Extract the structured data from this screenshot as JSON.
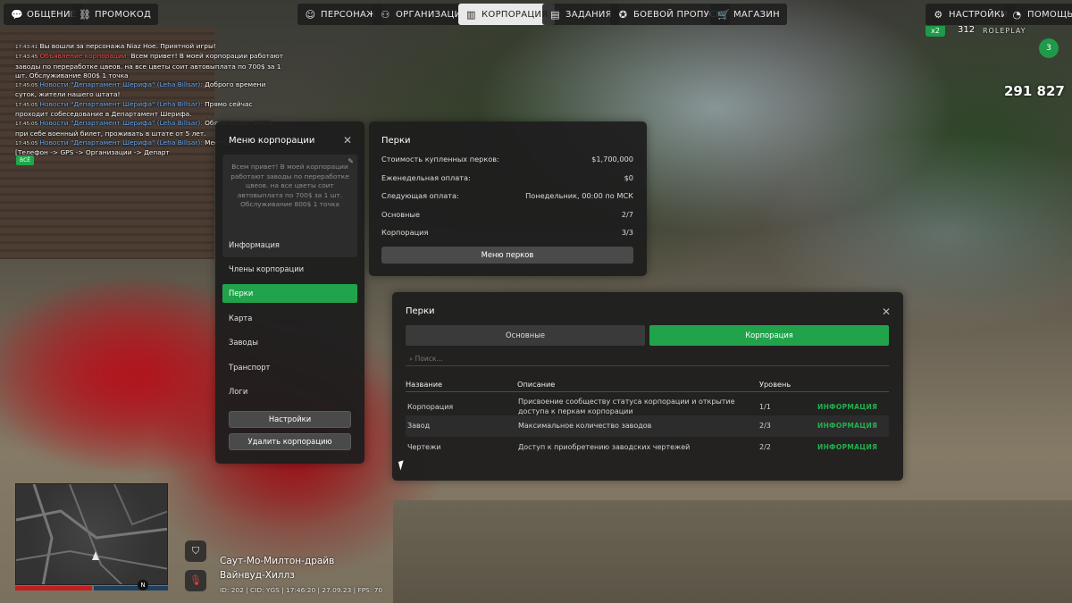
{
  "topbar": {
    "left": [
      {
        "label": "ОБЩЕНИЕ",
        "icon": "chat-icon"
      },
      {
        "label": "ПРОМОКОД",
        "icon": "gift-icon"
      }
    ],
    "center": [
      {
        "label": "ПЕРСОНАЖ",
        "icon": "user-icon"
      },
      {
        "label": "ОРГАНИЗАЦИЯ",
        "icon": "group-icon"
      },
      {
        "label": "КОРПОРАЦИЯ",
        "icon": "building-icon",
        "active": true
      },
      {
        "label": "ЗАДАНИЯ",
        "icon": "tasks-icon"
      },
      {
        "label": "БОЕВОЙ ПРОПУСК",
        "icon": "pass-icon"
      },
      {
        "label": "МАГАЗИН",
        "icon": "cart-icon"
      }
    ],
    "right": [
      {
        "label": "НАСТРОЙКИ",
        "icon": "gear-icon"
      },
      {
        "label": "ПОМОЩЬ",
        "icon": "help-icon"
      }
    ]
  },
  "chat": {
    "lines": [
      {
        "time": "17:43:41",
        "prefix": "",
        "text": "Вы вошли за персонажа Niaz Hoe. Приятной игры!"
      },
      {
        "time": "17:43:45",
        "prefix": "Объявление корпорации:",
        "text": "Всем привет! В моей корпорации работают заводы по переработке цвеов. на все цветы соит автовыплата по 700$ за 1 шт. Обслуживание 800$ 1 точка"
      },
      {
        "time": "17:45:05",
        "prefix": "Новости \"Департамент Шерифа\" (Leha Billsar):",
        "text": "Доброго времени суток, жители нашего штата!"
      },
      {
        "time": "17:45:05",
        "prefix": "Новости \"Департамент Шерифа\" (Leha Billsar):",
        "text": "Прямо сейчас проходит собеседование в Департамент Шерифа."
      },
      {
        "time": "17:45:05",
        "prefix": "Новости \"Департамент Шерифа\" (Leha Billsar):",
        "text": "Обязательно иметь при себе военный билет, проживать в штате от 5 лет."
      },
      {
        "time": "17:45:05",
        "prefix": "Новости \"Департамент Шерифа\" (Leha Billsar):",
        "text": "Место департамента [Телефон -> GPS -> Организации -> Департ"
      }
    ],
    "filter_button": "ВСЁ"
  },
  "hud": {
    "multiplier": "x2",
    "online": "312",
    "logo": "ROLEPLAY",
    "level": "3",
    "money": "291 827"
  },
  "menu": {
    "title": "Меню корпорации",
    "description": "Всем привет! В моей корпорации работают заводы по переработке цвеов. на все цветы соит автовыплата по 700$ за 1 шт. Обслуживание 800$ 1 точка",
    "items": [
      "Информация",
      "Члены корпорации",
      "Перки",
      "Карта",
      "Заводы",
      "Транспорт",
      "Логи"
    ],
    "active_index": 2,
    "settings_button": "Настройки",
    "delete_button": "Удалить корпорацию"
  },
  "summary": {
    "title": "Перки",
    "rows": [
      {
        "label": "Стоимость купленных перков:",
        "value": "$1,700,000"
      },
      {
        "label": "Еженедельная оплата:",
        "value": "$0"
      },
      {
        "label": "Следующая оплата:",
        "value": "Понедельник, 00:00 по МСК"
      },
      {
        "label": "Основные",
        "value": "2/7"
      },
      {
        "label": "Корпорация",
        "value": "3/3"
      }
    ],
    "button": "Меню перков"
  },
  "perks": {
    "title": "Перки",
    "tabs": [
      "Основные",
      "Корпорация"
    ],
    "search_placeholder": "Поиск...",
    "headers": [
      "Название",
      "Описание",
      "Уровень"
    ],
    "rows": [
      {
        "name": "Корпорация",
        "desc": "Присвоение сообществу статуса корпорации и открытие доступа к перкам корпорации",
        "level": "1/1",
        "action": "ИНФОРМАЦИЯ"
      },
      {
        "name": "Завод",
        "desc": "Максимальное количество заводов",
        "level": "2/3",
        "action": "ИНФОРМАЦИЯ"
      },
      {
        "name": "Чертежи",
        "desc": "Доступ к приобретению заводских чертежей",
        "level": "2/2",
        "action": "ИНФОРМАЦИЯ"
      }
    ]
  },
  "bottom": {
    "street1": "Саут-Мо-Милтон-драйв",
    "street2": "Вайнвуд-Хиллз",
    "status": "ID: 202 | CID: YGS | 17:46:20 | 27.09.23 | FPS: 70",
    "compass": "N"
  }
}
